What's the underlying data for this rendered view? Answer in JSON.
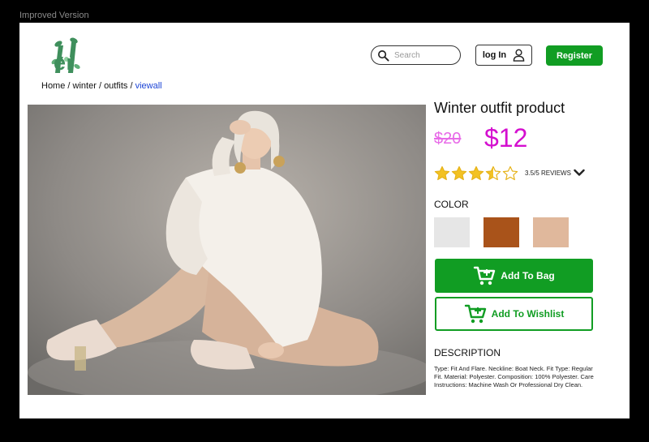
{
  "frame_label": "Improved Version",
  "brand": {
    "logo_text": "er",
    "accent_color": "#3f8f5c"
  },
  "breadcrumb": {
    "items": [
      "Home",
      "winter",
      "outfits"
    ],
    "separator": "/",
    "link": "viewall"
  },
  "header": {
    "search_placeholder": "Search",
    "login_label": "log In",
    "register_label": "Register",
    "brand_green": "#119d23"
  },
  "product": {
    "title": "Winter outfit product",
    "old_price": "$20",
    "new_price": "$12",
    "rating": 3.5,
    "rating_max": 5,
    "reviews_text": "3.5/5 REVIEWS",
    "color_label": "COLOR",
    "colors": [
      "#e6e6e6",
      "#a9531a",
      "#e0b89c"
    ],
    "add_to_bag_label": "Add To Bag",
    "add_to_wishlist_label": "Add To Wishlist",
    "description_label": "DESCRIPTION",
    "description": "Type: Fit And Flare. Neckline: Boat Neck. Fit Type: Regular Fit. Material: Polyester. Composition: 100% Polyester. Care Instructions: Machine Wash Or Professional Dry Clean."
  },
  "icons": {
    "search": "search-icon",
    "user": "user-icon",
    "cart": "cart-icon",
    "star": "star-icon",
    "chevron": "chevron-down-icon"
  }
}
